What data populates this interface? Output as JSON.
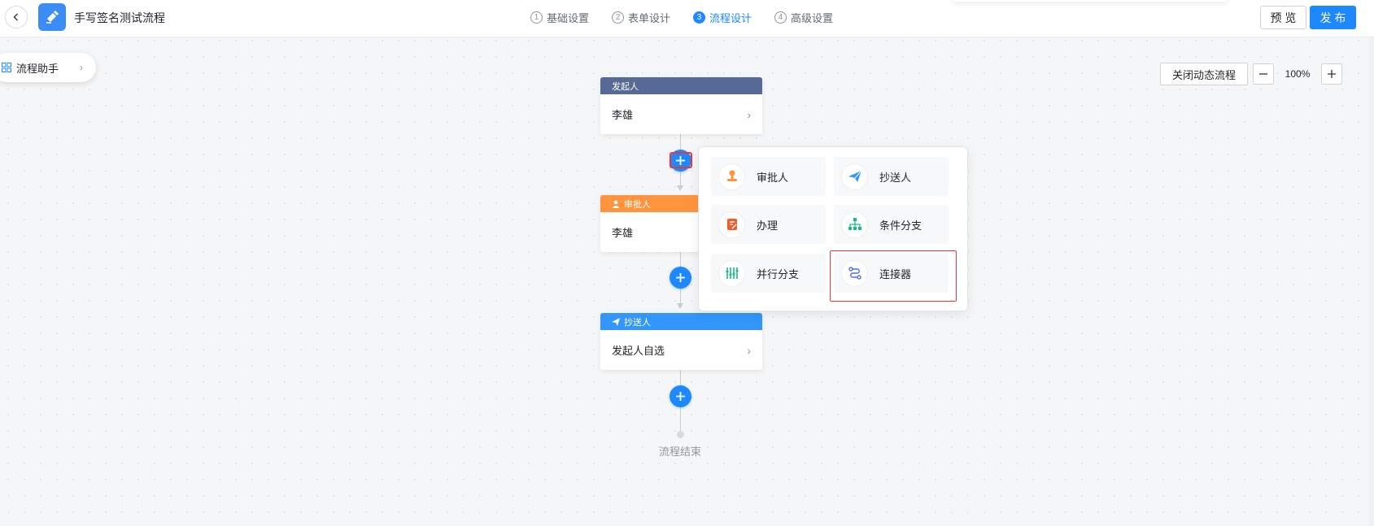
{
  "header": {
    "title": "手写签名测试流程",
    "steps": [
      {
        "num": "1",
        "label": "基础设置"
      },
      {
        "num": "2",
        "label": "表单设计"
      },
      {
        "num": "3",
        "label": "流程设计"
      },
      {
        "num": "4",
        "label": "高级设置"
      }
    ],
    "active_step": 2,
    "preview_label": "预 览",
    "publish_label": "发 布"
  },
  "assistant": {
    "label": "流程助手"
  },
  "zoom": {
    "toggle_label": "关闭动态流程",
    "level": "100%"
  },
  "flow": {
    "initiator": {
      "header": "发起人",
      "value": "李雄"
    },
    "approver": {
      "header": "审批人",
      "value": "李雄"
    },
    "cc": {
      "header": "抄送人",
      "value": "发起人自选"
    },
    "end_label": "流程结束"
  },
  "popover": {
    "items": [
      {
        "label": "审批人",
        "icon": "approver-stamp-icon"
      },
      {
        "label": "抄送人",
        "icon": "paper-plane-icon"
      },
      {
        "label": "办理",
        "icon": "handle-doc-icon"
      },
      {
        "label": "条件分支",
        "icon": "org-tree-icon"
      },
      {
        "label": "并行分支",
        "icon": "parallel-branch-icon"
      },
      {
        "label": "连接器",
        "icon": "connector-icon"
      }
    ]
  },
  "colors": {
    "accent": "#1e88ff",
    "initiator_header": "#576a95",
    "approver_header": "#ff943e",
    "cc_header": "#3296fa",
    "highlight": "#e5383b"
  }
}
